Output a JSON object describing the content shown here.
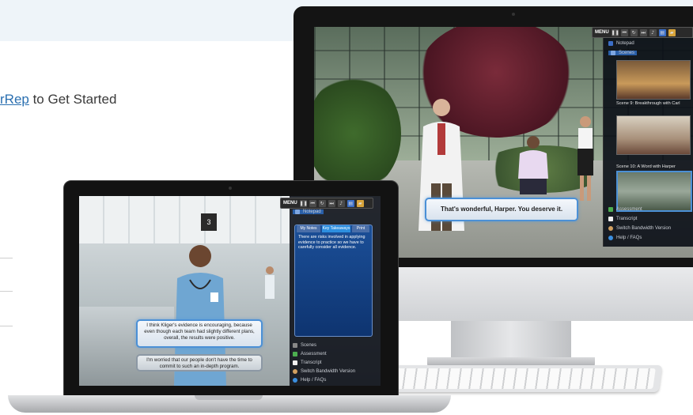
{
  "page": {
    "cta_prefix_link": "rRep",
    "cta_suffix": " to Get Started"
  },
  "imac": {
    "player": {
      "menu_label": "MENU",
      "controls": [
        "pause-icon",
        "skip-back-icon",
        "replay-icon",
        "skip-forward-icon",
        "volume-icon",
        "notepad-icon",
        "folder-icon"
      ]
    },
    "side_panel": {
      "notepad_label": "Notepad",
      "scenes_label": "Scenes",
      "scenes": [
        {
          "caption": ""
        },
        {
          "caption": "Scene 9: Breakthrough with Carl"
        },
        {
          "caption": "Scene 10: A Word with Harper"
        }
      ],
      "menu_items": [
        {
          "label": "Assessment",
          "icon": "checkbox-checked-icon"
        },
        {
          "label": "Transcript",
          "icon": "document-icon"
        },
        {
          "label": "Switch Bandwidth Version",
          "icon": "bandwidth-icon"
        },
        {
          "label": "Help / FAQs",
          "icon": "help-icon"
        }
      ]
    },
    "dialogue": "That's wonderful, Harper. You deserve it."
  },
  "macbook": {
    "player": {
      "menu_label": "MENU",
      "controls": [
        "pause-icon",
        "skip-back-icon",
        "replay-icon",
        "skip-forward-icon",
        "volume-icon",
        "notepad-icon",
        "folder-icon"
      ]
    },
    "room_sign": "3",
    "notepad": {
      "title": "Notepad",
      "tabs": [
        "My Notes",
        "Key Takeaways",
        "Print"
      ],
      "text": "There are risks involved in applying evidence to practice so we have to carefully consider all evidence."
    },
    "side_panel": {
      "menu_items": [
        {
          "label": "Scenes",
          "icon": "scenes-icon"
        },
        {
          "label": "Assessment",
          "icon": "checkbox-checked-icon"
        },
        {
          "label": "Transcript",
          "icon": "document-icon"
        },
        {
          "label": "Switch Bandwidth Version",
          "icon": "bandwidth-icon"
        },
        {
          "label": "Help / FAQs",
          "icon": "help-icon"
        }
      ]
    },
    "choice_1": "I think Kliger's evidence is encouraging, because even though each team had slightly different plans, overall, the results were positive.",
    "choice_2": "I'm worried that our people don't have the time to commit to such an in-depth program."
  },
  "colors": {
    "accent": "#4b90d6",
    "link": "#2a6fb0",
    "panel": "#0a0e16"
  }
}
